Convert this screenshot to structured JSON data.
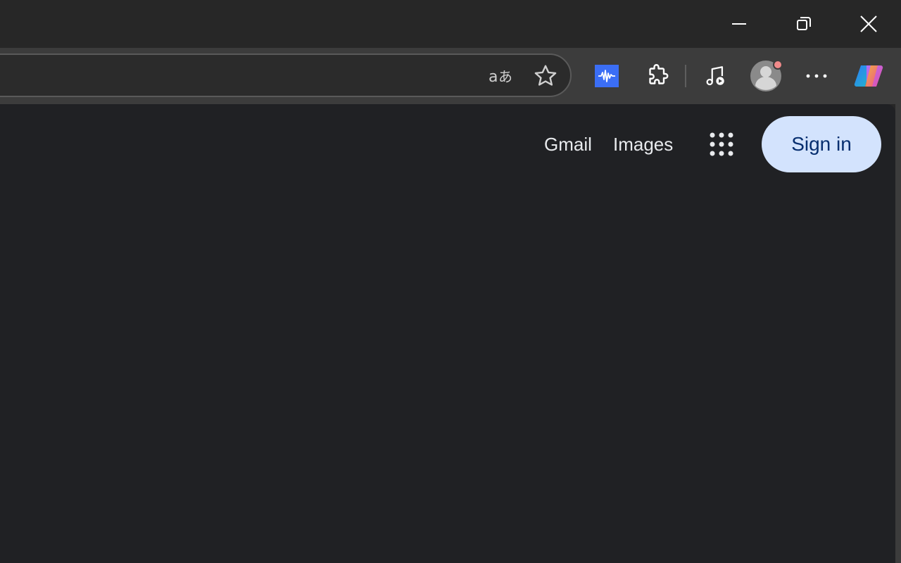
{
  "window": {
    "minimize_icon": "minimize-icon",
    "restore_icon": "restore-icon",
    "close_icon": "close-icon"
  },
  "toolbar": {
    "translate_icon": "translate-icon",
    "favorite_icon": "star-icon",
    "extension_icon": "audio-wave-extension-icon",
    "extensions_icon": "puzzle-icon",
    "media_icon": "music-note-icon",
    "profile_icon": "avatar-icon",
    "more_icon": "more-horizontal-icon",
    "copilot_icon": "copilot-icon"
  },
  "header": {
    "gmail": "Gmail",
    "images": "Images",
    "sign_in": "Sign in"
  },
  "colors": {
    "content_bg": "#202124",
    "sign_in_bg": "#d3e3fd",
    "sign_in_text": "#062e6f",
    "extension_blue": "#3b6ef5"
  }
}
